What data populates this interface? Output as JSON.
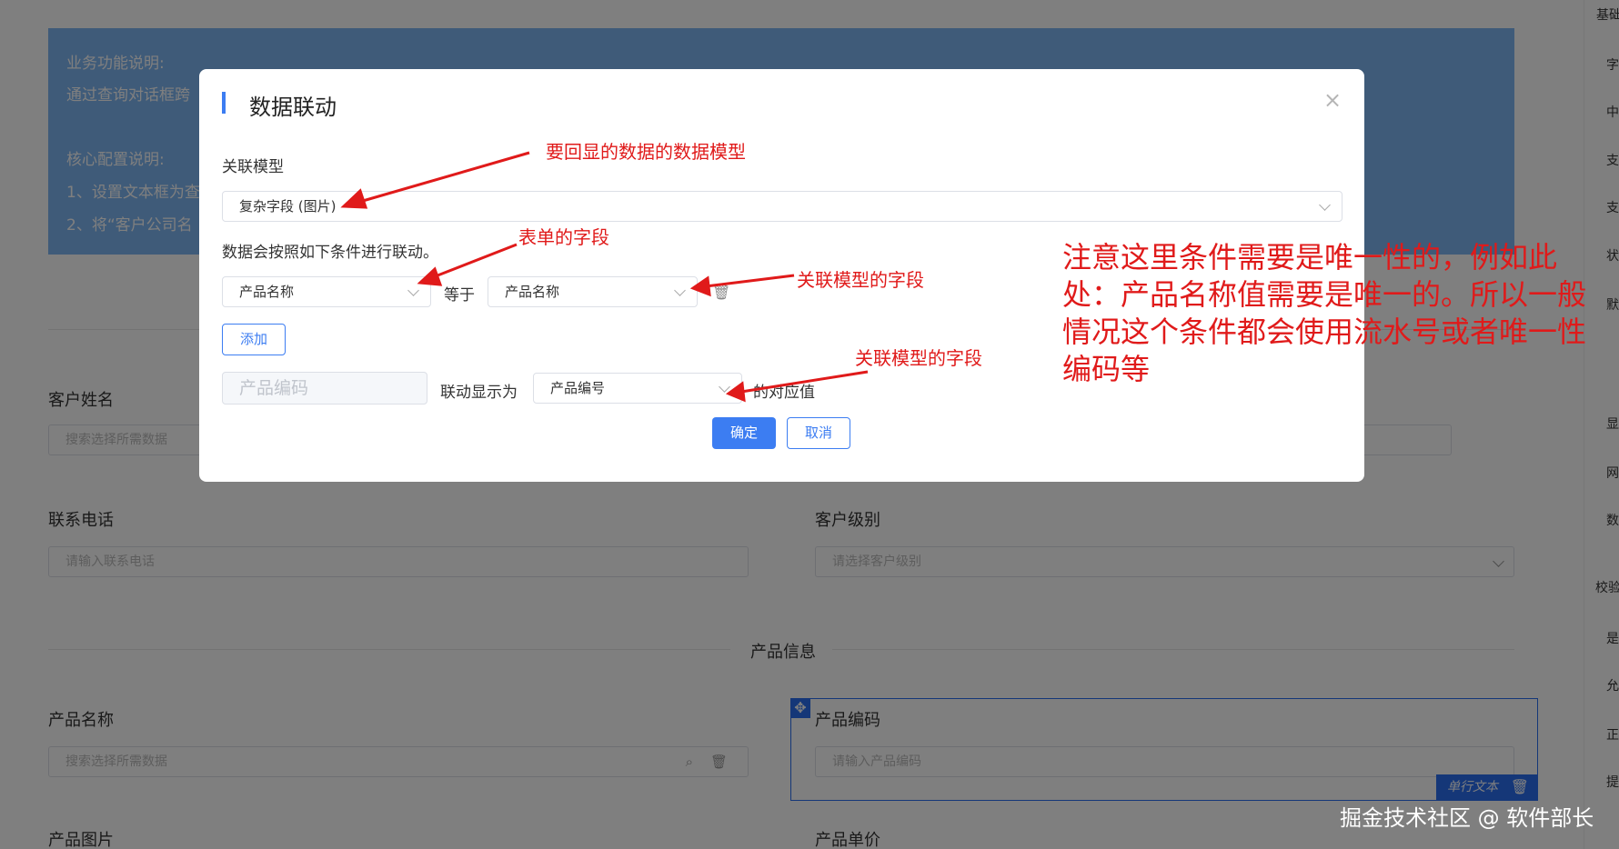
{
  "background": {
    "info_lines": [
      "业务功能说明:",
      "通过查询对话框跨",
      "核心配置说明:",
      "1、设置文本框为查",
      "2、将“客户公司名"
    ],
    "fields": {
      "customer_name": {
        "label": "客户姓名",
        "placeholder": "搜索选择所需数据"
      },
      "contact_phone": {
        "label": "联系电话",
        "placeholder": "请输入联系电话"
      },
      "customer_level": {
        "label": "客户级别",
        "placeholder": "请选择客户级别"
      },
      "product_name": {
        "label": "产品名称",
        "placeholder": "搜索选择所需数据"
      },
      "product_code": {
        "label": "产品编码",
        "placeholder": "请输入产品编码"
      },
      "product_image": {
        "label": "产品图片"
      },
      "product_price": {
        "label": "产品单价"
      }
    },
    "section_product": "产品信息",
    "selected_type_badge": "单行文本",
    "right_panel_items": [
      "基础",
      "字",
      "中",
      "支",
      "支",
      "状",
      "默",
      "显",
      "网",
      "数",
      "校验",
      "是",
      "允",
      "正",
      "提"
    ]
  },
  "modal": {
    "title": "数据联动",
    "related_model_label": "关联模型",
    "related_model_value": "复杂字段 (图片)",
    "condition_hint": "数据会按照如下条件进行联动。",
    "condition": {
      "left_field": "产品名称",
      "operator": "等于",
      "right_field": "产品名称"
    },
    "add_button": "添加",
    "display": {
      "target_field": "产品编码",
      "label": "联动显示为",
      "source_field": "产品编号",
      "suffix": "的对应值"
    },
    "ok_button": "确定",
    "cancel_button": "取消"
  },
  "annotations": {
    "model_note": "要回显的数据的数据模型",
    "form_field_note": "表单的字段",
    "related_field_note_1": "关联模型的字段",
    "related_field_note_2": "关联模型的字段",
    "big_note_lines": [
      "注意这里条件需要是唯一性的，例如此",
      "处：产品名称值需要是唯一的。所以一般",
      "情况这个条件都会使用流水号或者唯一性",
      "编码等"
    ]
  },
  "watermark": "掘金技术社区 @ 软件部长",
  "colors": {
    "accent": "#3c7df2",
    "annotation_red": "#e01a1a",
    "info_box": "#7fb6f2",
    "mask": "rgba(0,0,0,0.5)"
  }
}
